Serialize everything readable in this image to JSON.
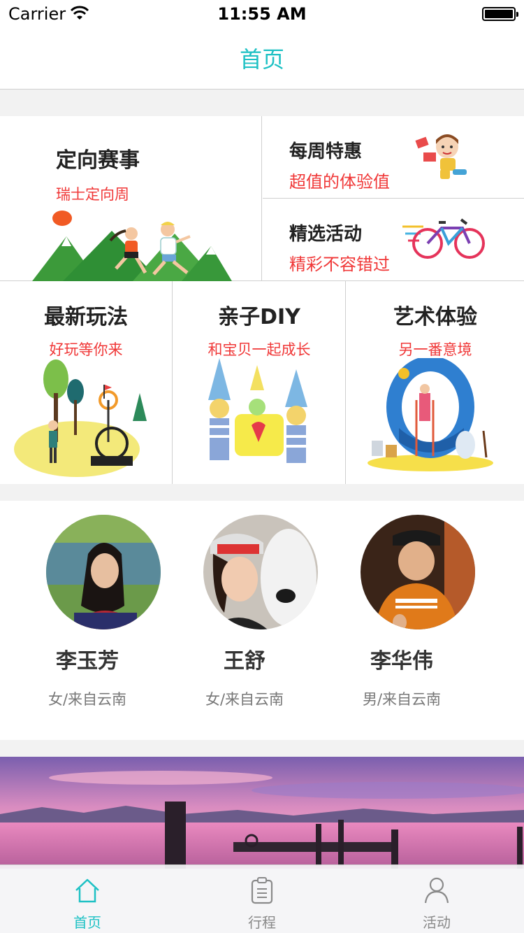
{
  "status_bar": {
    "carrier": "Carrier",
    "time": "11:55 AM"
  },
  "nav": {
    "title": "首页"
  },
  "featured": {
    "main": {
      "title": "定向赛事",
      "subtitle": "瑞士定向周"
    },
    "side": [
      {
        "title": "每周特惠",
        "subtitle": "超值的体验值"
      },
      {
        "title": "精选活动",
        "subtitle": "精彩不容错过"
      }
    ]
  },
  "categories": [
    {
      "title": "最新玩法",
      "subtitle": "好玩等你来"
    },
    {
      "title": "亲子DIY",
      "subtitle": "和宝贝一起成长"
    },
    {
      "title": "艺术体验",
      "subtitle": "另一番意境"
    }
  ],
  "people": [
    {
      "name": "李玉芳",
      "info": "女/来自云南"
    },
    {
      "name": "王舒",
      "info": "女/来自云南"
    },
    {
      "name": "李华伟",
      "info": "男/来自云南"
    }
  ],
  "tabbar": {
    "items": [
      {
        "label": "首页",
        "icon": "home-icon",
        "active": true
      },
      {
        "label": "行程",
        "icon": "clipboard-icon",
        "active": false
      },
      {
        "label": "活动",
        "icon": "person-icon",
        "active": false
      }
    ]
  },
  "colors": {
    "accent": "#1ec1c4",
    "subtitle_red": "#f03838"
  }
}
